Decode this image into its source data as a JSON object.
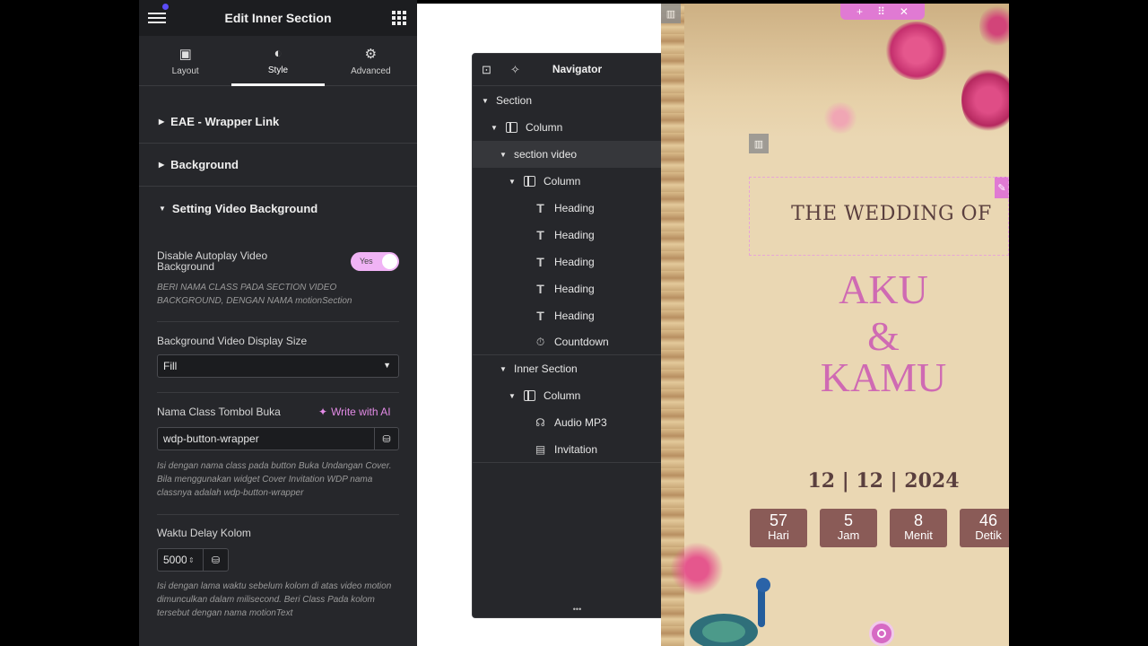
{
  "panel": {
    "title": "Edit Inner Section",
    "tabs": [
      {
        "label": "Layout",
        "icon": "layout-icon"
      },
      {
        "label": "Style",
        "icon": "style-contrast-icon",
        "active": true
      },
      {
        "label": "Advanced",
        "icon": "gear-icon"
      }
    ],
    "sections": [
      {
        "label": "EAE - Wrapper Link",
        "expanded": false
      },
      {
        "label": "Background",
        "expanded": false
      },
      {
        "label": "Setting Video Background",
        "expanded": true
      }
    ],
    "autoplay": {
      "label": "Disable Autoplay Video Background",
      "toggle_text": "Yes",
      "note": "BERI NAMA CLASS PADA SECTION VIDEO BACKGROUND, DENGAN NAMA motionSection"
    },
    "display_size": {
      "label": "Background Video Display Size",
      "value": "Fill"
    },
    "class_button": {
      "label": "Nama Class Tombol Buka",
      "ai_label": "Write with AI",
      "value": "wdp-button-wrapper",
      "note": "Isi dengan nama class pada button Buka Undangan Cover. Bila menggunakan widget Cover Invitation WDP nama classnya adalah wdp-button-wrapper"
    },
    "delay": {
      "label": "Waktu Delay Kolom",
      "value": "5000",
      "note": "Isi dengan lama waktu sebelum kolom di atas video motion dimunculkan dalam milisecond. Beri Class Pada kolom tersebut dengan nama motionText"
    }
  },
  "navigator": {
    "title": "Navigator",
    "items": [
      {
        "label": "Section",
        "type": "section",
        "depth": 0
      },
      {
        "label": "Column",
        "type": "column",
        "depth": 1
      },
      {
        "label": "section video",
        "type": "section",
        "depth": 2,
        "selected": true
      },
      {
        "label": "Column",
        "type": "column",
        "depth": 3
      },
      {
        "label": "Heading",
        "type": "heading",
        "depth": 4
      },
      {
        "label": "Heading",
        "type": "heading",
        "depth": 4
      },
      {
        "label": "Heading",
        "type": "heading",
        "depth": 4
      },
      {
        "label": "Heading",
        "type": "heading",
        "depth": 4
      },
      {
        "label": "Heading",
        "type": "heading",
        "depth": 4
      },
      {
        "label": "Countdown",
        "type": "countdown",
        "depth": 4
      },
      {
        "label": "Inner Section",
        "type": "section",
        "depth": 2
      },
      {
        "label": "Column",
        "type": "column",
        "depth": 3
      },
      {
        "label": "Audio MP3",
        "type": "audio",
        "depth": 4
      },
      {
        "label": "Invitation",
        "type": "invitation",
        "depth": 4
      }
    ]
  },
  "preview": {
    "heading": "THE WEDDING OF",
    "name1": "AKU",
    "amp": "&",
    "name2": "KAMU",
    "date": "12 | 12 | 2024",
    "countdown": [
      {
        "value": "57",
        "unit": "Hari"
      },
      {
        "value": "5",
        "unit": "Jam"
      },
      {
        "value": "8",
        "unit": "Menit"
      },
      {
        "value": "46",
        "unit": "Detik"
      }
    ],
    "colors": {
      "accent": "#e07ad3",
      "name": "#cf6ab3",
      "countdown_box": "#8a5b57"
    }
  }
}
